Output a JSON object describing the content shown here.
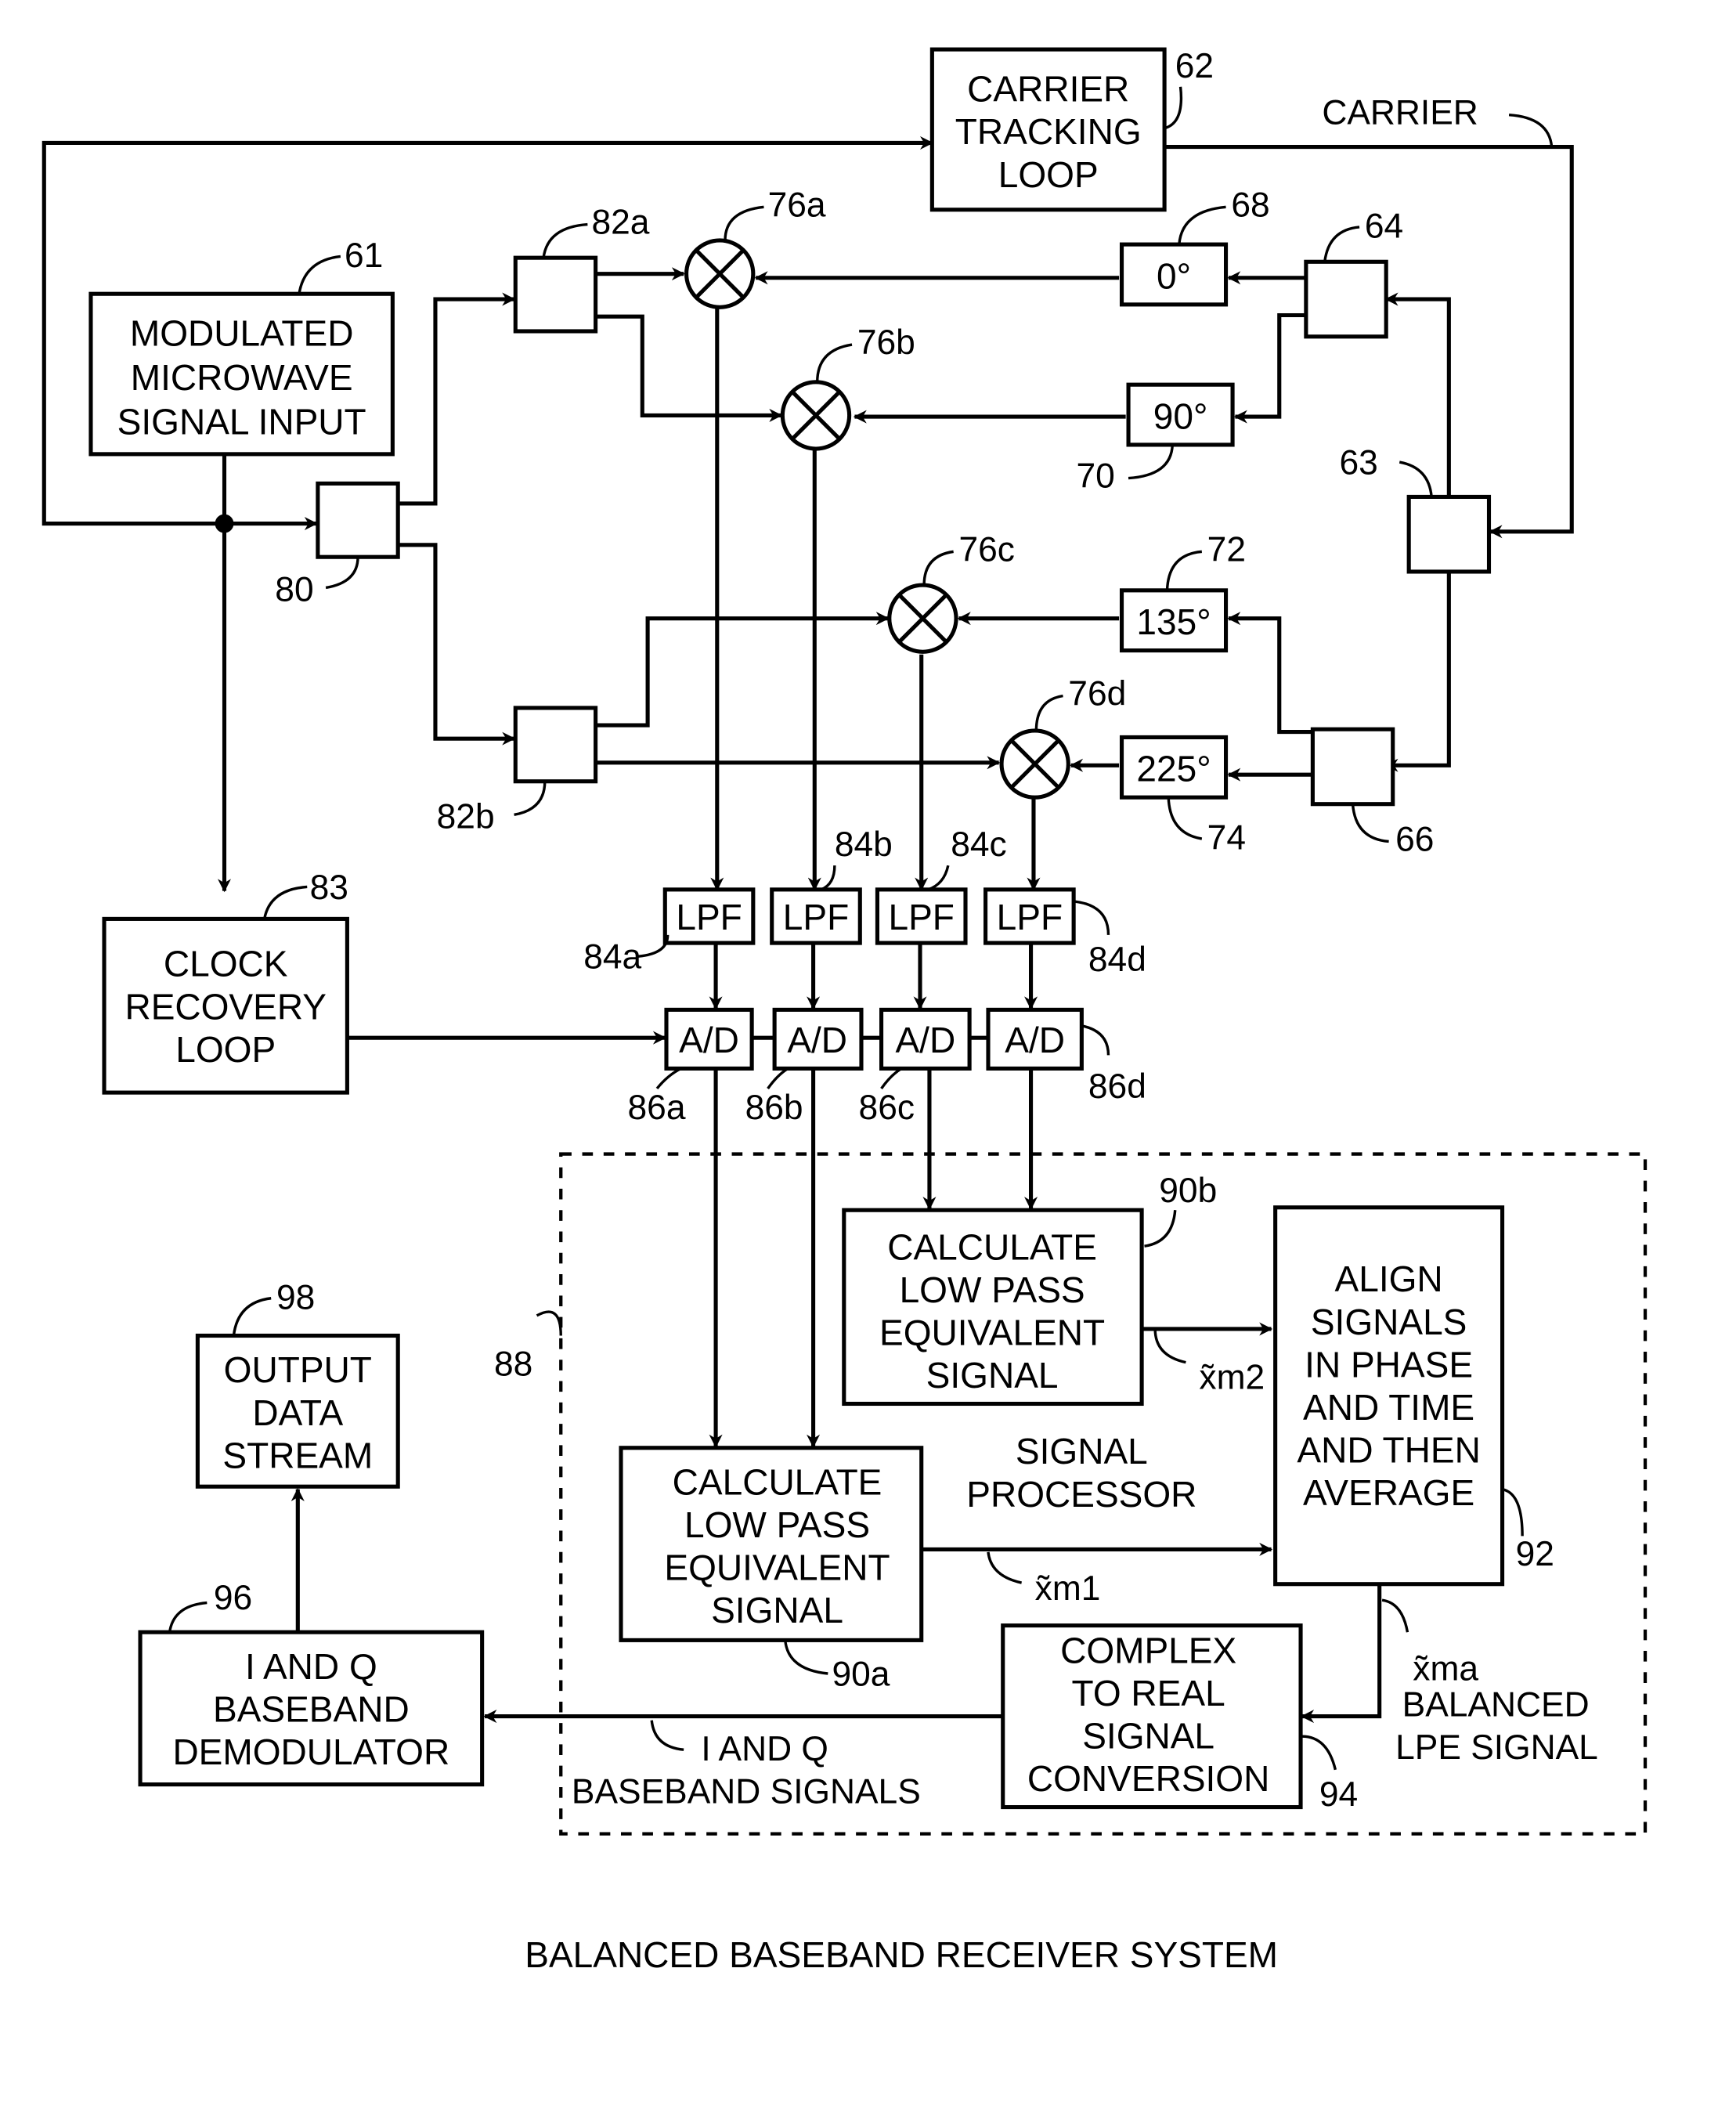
{
  "title": "BALANCED BASEBAND RECEIVER SYSTEM",
  "blocks": {
    "input": {
      "ref": "61",
      "lines": [
        "MODULATED",
        "MICROWAVE",
        "SIGNAL INPUT"
      ]
    },
    "carrier_loop": {
      "ref": "62",
      "lines": [
        "CARRIER",
        "TRACKING",
        "LOOP"
      ]
    },
    "clock_loop": {
      "ref": "83",
      "lines": [
        "CLOCK",
        "RECOVERY",
        "LOOP"
      ]
    },
    "lpe_a": {
      "ref": "90a",
      "lines": [
        "CALCULATE",
        "LOW PASS",
        "EQUIVALENT",
        "SIGNAL"
      ]
    },
    "lpe_b": {
      "ref": "90b",
      "lines": [
        "CALCULATE",
        "LOW PASS",
        "EQUIVALENT",
        "SIGNAL"
      ]
    },
    "align": {
      "ref": "92",
      "lines": [
        "ALIGN",
        "SIGNALS",
        "IN PHASE",
        "AND TIME",
        "AND THEN",
        "AVERAGE"
      ]
    },
    "c2r": {
      "ref": "94",
      "lines": [
        "COMPLEX",
        "TO REAL",
        "SIGNAL",
        "CONVERSION"
      ]
    },
    "demod": {
      "ref": "96",
      "lines": [
        "I AND Q",
        "BASEBAND",
        "DEMODULATOR"
      ]
    },
    "output": {
      "ref": "98",
      "lines": [
        "OUTPUT",
        "DATA",
        "STREAM"
      ]
    }
  },
  "phases": {
    "p0": "0°",
    "p90": "90°",
    "p135": "135°",
    "p225": "225°"
  },
  "phase_refs": {
    "p0": "68",
    "p90": "70",
    "p135": "72",
    "p225": "74"
  },
  "splitters": {
    "s80": "80",
    "s82a": "82a",
    "s82b": "82b",
    "s63": "63",
    "s64": "64",
    "s66": "66"
  },
  "mixers": [
    "76a",
    "76b",
    "76c",
    "76d"
  ],
  "lpf": {
    "label": "LPF",
    "refs": [
      "84a",
      "84b",
      "84c",
      "84d"
    ]
  },
  "adc": {
    "label": "A/D",
    "refs": [
      "86a",
      "86b",
      "86c",
      "86d"
    ]
  },
  "labels": {
    "carrier": "CARRIER",
    "signal_processor_1": "SIGNAL",
    "signal_processor_2": "PROCESSOR",
    "sp_ref": "88",
    "xm1": "x̃m1",
    "xm2": "x̃m2",
    "xma": "x̃ma",
    "balanced_1": "BALANCED",
    "balanced_2": "LPE SIGNAL",
    "iq_1": "I AND Q",
    "iq_2": "BASEBAND  SIGNALS"
  }
}
